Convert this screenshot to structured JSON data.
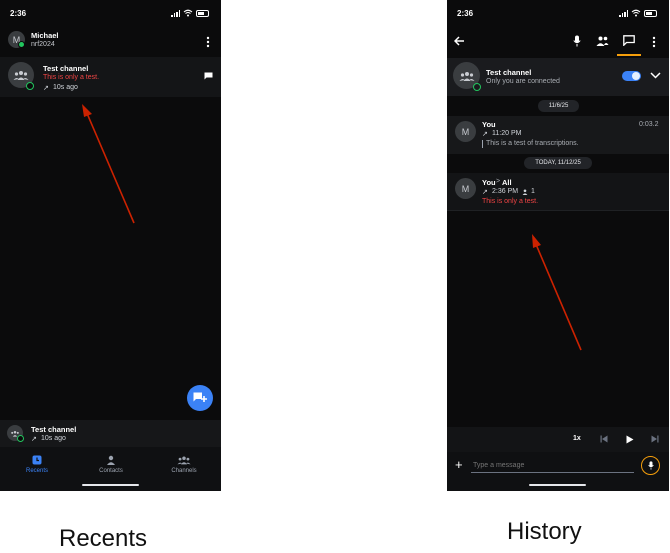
{
  "left_screen": {
    "status_time": "2:36",
    "profile": {
      "initial": "M",
      "name": "Michael",
      "subtitle": "nrf2024"
    },
    "recent_item": {
      "title": "Test channel",
      "message": "This is only a test.",
      "arrow": "↗",
      "time": "10s ago"
    },
    "now_playing": {
      "title": "Test channel",
      "arrow": "↗",
      "time": "10s ago"
    },
    "tabs": [
      {
        "label": "Recents",
        "icon": "clock-icon",
        "active": true
      },
      {
        "label": "Contacts",
        "icon": "person-icon",
        "active": false
      },
      {
        "label": "Channels",
        "icon": "group-icon",
        "active": false
      }
    ]
  },
  "right_screen": {
    "status_time": "2:36",
    "channel": {
      "title": "Test channel",
      "subtitle": "Only you are connected"
    },
    "date1": "11/6/25",
    "msg1": {
      "initial": "M",
      "sender": "You",
      "arrow": "↗",
      "time": "11:20 PM",
      "duration": "0:03.2",
      "text": "This is a test of transcriptions."
    },
    "date2": "TODAY, 11/12/25",
    "msg2": {
      "initial": "M",
      "sender": "You",
      "sep": ">",
      "target": "All",
      "arrow": "↗",
      "time": "2:36 PM",
      "count": "1",
      "text": "This is only a test."
    },
    "playback": {
      "speed": "1x"
    },
    "composer": {
      "placeholder": "Type a message",
      "plus": "+"
    }
  },
  "captions": {
    "left": "Recents",
    "right": "History"
  },
  "colors": {
    "background": "#0b0b0c",
    "accent": "#3b82f6",
    "online": "#22c55e",
    "alert": "#ef4444",
    "annotation": "#cc2200",
    "mic_ring": "#f59e0b"
  }
}
